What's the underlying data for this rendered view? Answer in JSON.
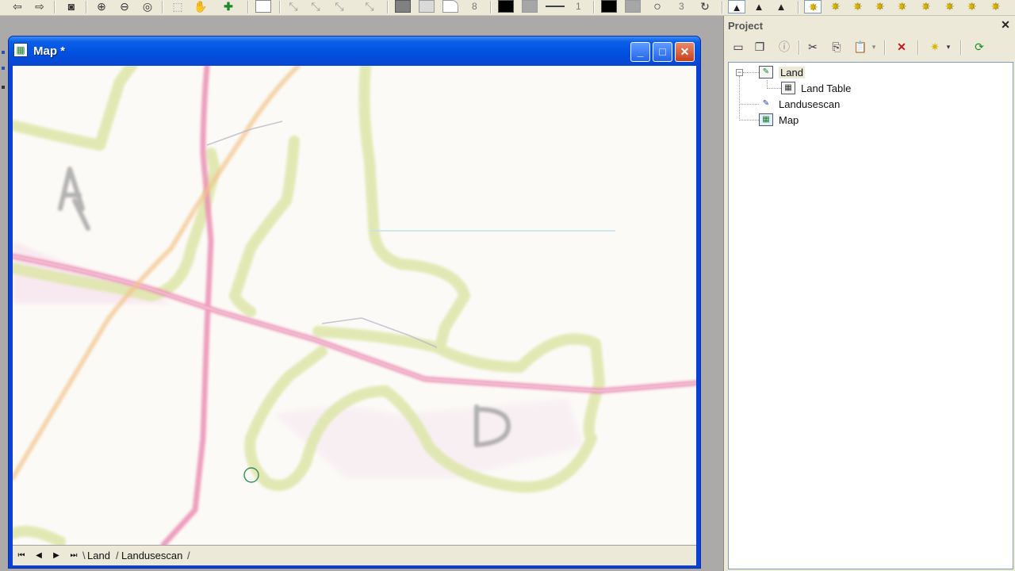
{
  "toolbar": {
    "icons": [
      "back-arrow-icon",
      "forward-arrow-icon",
      "zoom-full-icon",
      "zoom-in-icon",
      "zoom-out-icon",
      "zoom-previous-icon",
      "zoom-to-selection-icon",
      "pan-hand-icon",
      "add-feature-icon",
      "fill-color-icon",
      "edit-vertex-icon"
    ],
    "colors": {
      "fill_dark": "#808080",
      "fill_light": "#d9d9d9",
      "black": "#000000",
      "gray": "#a6a6a6"
    },
    "numbers": [
      "8",
      "1",
      "3"
    ]
  },
  "map_window": {
    "title": "Map *",
    "minimize_label": "_",
    "maximize_label": "□",
    "close_label": "✕",
    "sheet_tabs": [
      "Land",
      "Landusescan"
    ]
  },
  "project": {
    "title": "Project",
    "close_label": "✕",
    "tree": [
      {
        "label": "Land",
        "icon": "edit-layer-icon",
        "expanded": true,
        "children": [
          {
            "label": "Land Table",
            "icon": "table-icon"
          }
        ]
      },
      {
        "label": "Landusescan",
        "icon": "scan-layer-icon"
      },
      {
        "label": "Map",
        "icon": "map-icon"
      }
    ]
  }
}
